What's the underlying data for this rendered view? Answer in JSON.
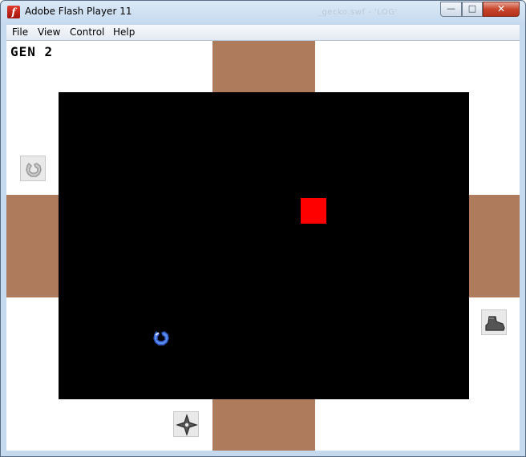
{
  "window": {
    "title": "Adobe Flash Player 11",
    "ghost_title": "_gecko.swf - 'LOG'",
    "controls": {
      "minimize_icon": "minimize-icon",
      "maximize_icon": "maximize-icon",
      "close_icon": "close-icon"
    }
  },
  "menu": {
    "items": [
      {
        "label": "File"
      },
      {
        "label": "View"
      },
      {
        "label": "Control"
      },
      {
        "label": "Help"
      }
    ]
  },
  "game": {
    "generation_label": "GEN 2",
    "colors": {
      "arena": "#000000",
      "door": "#ae7c5c",
      "enemy": "#ff0000",
      "player": "#5b8ef0",
      "background": "#ffffff"
    },
    "entities": {
      "enemy": "red-square-enemy",
      "player": "blue-swirl-player"
    },
    "side_items": [
      {
        "name": "swirl-item-icon",
        "side": "left"
      },
      {
        "name": "boot-item-icon",
        "side": "right"
      },
      {
        "name": "shuriken-item-icon",
        "side": "bottom"
      }
    ]
  }
}
